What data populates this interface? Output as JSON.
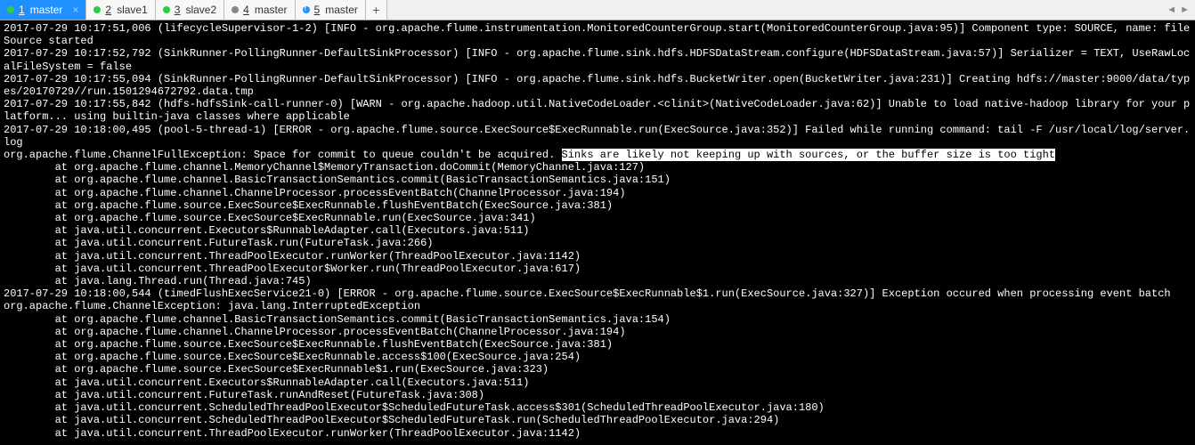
{
  "tabs": [
    {
      "num": "1",
      "label": "master",
      "status": "green",
      "active": true
    },
    {
      "num": "2",
      "label": "slave1",
      "status": "green",
      "active": false
    },
    {
      "num": "3",
      "label": "slave2",
      "status": "green",
      "active": false
    },
    {
      "num": "4",
      "label": "master",
      "status": "grey",
      "active": false
    },
    {
      "num": "5",
      "label": "master",
      "status": "blue",
      "active": false
    }
  ],
  "add_tab_label": "+",
  "nav": {
    "prev": "◄",
    "next": "►"
  },
  "highlight": "Sinks are likely not keeping up with sources, or the buffer size is too tight",
  "log": [
    "2017-07-29 10:17:51,006 (lifecycleSupervisor-1-2) [INFO - org.apache.flume.instrumentation.MonitoredCounterGroup.start(MonitoredCounterGroup.java:95)] Component type: SOURCE, name: fileSource started",
    "2017-07-29 10:17:52,792 (SinkRunner-PollingRunner-DefaultSinkProcessor) [INFO - org.apache.flume.sink.hdfs.HDFSDataStream.configure(HDFSDataStream.java:57)] Serializer = TEXT, UseRawLocalFileSystem = false",
    "2017-07-29 10:17:55,094 (SinkRunner-PollingRunner-DefaultSinkProcessor) [INFO - org.apache.flume.sink.hdfs.BucketWriter.open(BucketWriter.java:231)] Creating hdfs://master:9000/data/types/20170729//run.1501294672792.data.tmp",
    "2017-07-29 10:17:55,842 (hdfs-hdfsSink-call-runner-0) [WARN - org.apache.hadoop.util.NativeCodeLoader.<clinit>(NativeCodeLoader.java:62)] Unable to load native-hadoop library for your platform... using builtin-java classes where applicable",
    "2017-07-29 10:18:00,495 (pool-5-thread-1) [ERROR - org.apache.flume.source.ExecSource$ExecRunnable.run(ExecSource.java:352)] Failed while running command: tail -F /usr/local/log/server.log",
    "org.apache.flume.ChannelFullException: Space for commit to queue couldn't be acquired. {{HL}}",
    "        at org.apache.flume.channel.MemoryChannel$MemoryTransaction.doCommit(MemoryChannel.java:127)",
    "        at org.apache.flume.channel.BasicTransactionSemantics.commit(BasicTransactionSemantics.java:151)",
    "        at org.apache.flume.channel.ChannelProcessor.processEventBatch(ChannelProcessor.java:194)",
    "        at org.apache.flume.source.ExecSource$ExecRunnable.flushEventBatch(ExecSource.java:381)",
    "        at org.apache.flume.source.ExecSource$ExecRunnable.run(ExecSource.java:341)",
    "        at java.util.concurrent.Executors$RunnableAdapter.call(Executors.java:511)",
    "        at java.util.concurrent.FutureTask.run(FutureTask.java:266)",
    "        at java.util.concurrent.ThreadPoolExecutor.runWorker(ThreadPoolExecutor.java:1142)",
    "        at java.util.concurrent.ThreadPoolExecutor$Worker.run(ThreadPoolExecutor.java:617)",
    "        at java.lang.Thread.run(Thread.java:745)",
    "2017-07-29 10:18:00,544 (timedFlushExecService21-0) [ERROR - org.apache.flume.source.ExecSource$ExecRunnable$1.run(ExecSource.java:327)] Exception occured when processing event batch",
    "org.apache.flume.ChannelException: java.lang.InterruptedException",
    "        at org.apache.flume.channel.BasicTransactionSemantics.commit(BasicTransactionSemantics.java:154)",
    "        at org.apache.flume.channel.ChannelProcessor.processEventBatch(ChannelProcessor.java:194)",
    "        at org.apache.flume.source.ExecSource$ExecRunnable.flushEventBatch(ExecSource.java:381)",
    "        at org.apache.flume.source.ExecSource$ExecRunnable.access$100(ExecSource.java:254)",
    "        at org.apache.flume.source.ExecSource$ExecRunnable$1.run(ExecSource.java:323)",
    "        at java.util.concurrent.Executors$RunnableAdapter.call(Executors.java:511)",
    "        at java.util.concurrent.FutureTask.runAndReset(FutureTask.java:308)",
    "        at java.util.concurrent.ScheduledThreadPoolExecutor$ScheduledFutureTask.access$301(ScheduledThreadPoolExecutor.java:180)",
    "        at java.util.concurrent.ScheduledThreadPoolExecutor$ScheduledFutureTask.run(ScheduledThreadPoolExecutor.java:294)",
    "        at java.util.concurrent.ThreadPoolExecutor.runWorker(ThreadPoolExecutor.java:1142)"
  ]
}
